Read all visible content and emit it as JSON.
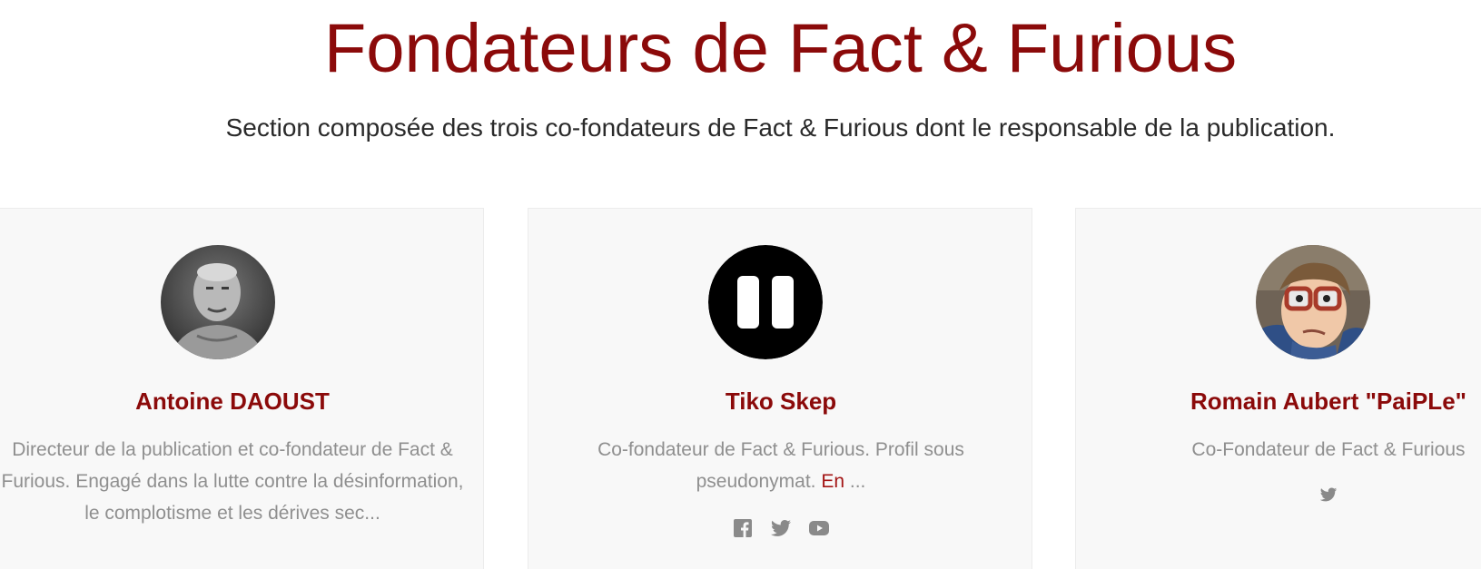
{
  "header": {
    "title": "Fondateurs de Fact & Furious",
    "subtitle": "Section composée des trois co-fondateurs de Fact & Furious dont le responsable de la publication."
  },
  "colors": {
    "accent": "#8b0a0a",
    "text_muted": "#8f8f8f",
    "card_bg": "#f8f8f8",
    "icon_gray": "#8a8a8a"
  },
  "founders": [
    {
      "name": "Antoine DAOUST",
      "description": "Directeur de la publication et co-fondateur de Fact & Furious. Engagé dans la lutte contre la désinformation, le complotisme et les dérives sec...",
      "avatar": "photo-portrait",
      "socials": []
    },
    {
      "name": "Tiko Skep",
      "description": "Co-fondateur de Fact & Furious. Profil sous pseudonymat.",
      "link_text": "En",
      "ellipsis": " ...",
      "avatar": "pause-logo",
      "socials": [
        "facebook-icon",
        "twitter-icon",
        "youtube-icon"
      ]
    },
    {
      "name": "Romain Aubert \"PaiPLe\"",
      "description": "Co-Fondateur de Fact & Furious",
      "avatar": "cartoon-portrait",
      "socials": [
        "twitter-icon"
      ]
    }
  ]
}
